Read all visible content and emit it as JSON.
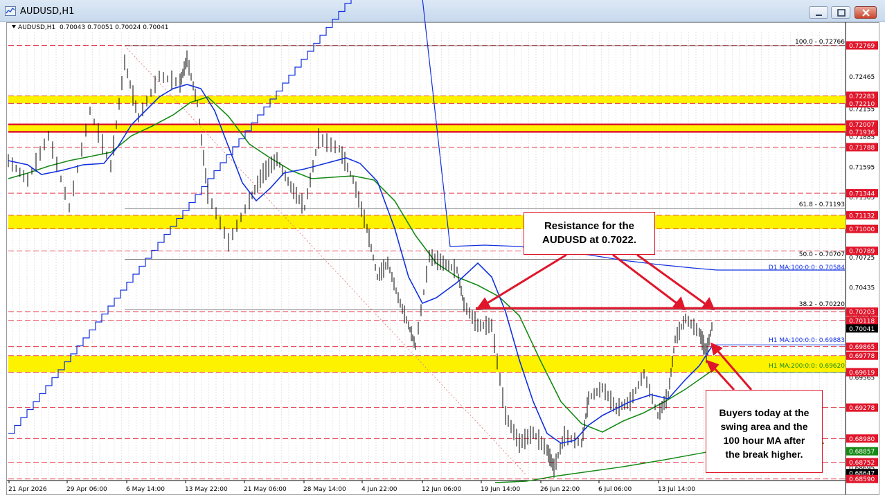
{
  "window": {
    "title": "AUDUSD,H1",
    "buttons": [
      "minimize-button",
      "maximize-button",
      "close-button"
    ]
  },
  "chart_info": {
    "symbol_timeframe": "AUDUSD,H1",
    "ohlc": "0.70043 0.70051 0.70024 0.70041"
  },
  "colors": {
    "zone_yellow": "#fdf200",
    "resistance_red": "#e0162b",
    "ma100_hourly": "#1030e0",
    "ma200_hourly": "#168a16",
    "ma100_daily": "#1030e0",
    "candles": "#000000"
  },
  "price_axis": {
    "ticks": [
      "0.72766",
      "0.72465",
      "0.72155",
      "0.71885",
      "0.71595",
      "0.71305",
      "0.71015",
      "0.70725",
      "0.70435",
      "0.70145",
      "0.69855",
      "0.69565",
      "0.69275",
      "0.68985",
      "0.68695"
    ],
    "tags": [
      {
        "text": "0.72769",
        "color": "#e0162b"
      },
      {
        "text": "0.72283",
        "color": "#e0162b"
      },
      {
        "text": "0.72210",
        "color": "#e0162b"
      },
      {
        "text": "0.72007",
        "color": "#e0162b"
      },
      {
        "text": "0.71936",
        "color": "#e0162b"
      },
      {
        "text": "0.71788",
        "color": "#e0162b"
      },
      {
        "text": "0.71344",
        "color": "#e0162b"
      },
      {
        "text": "0.71132",
        "color": "#e0162b"
      },
      {
        "text": "0.71000",
        "color": "#e0162b"
      },
      {
        "text": "0.70789",
        "color": "#e0162b"
      },
      {
        "text": "0.70203",
        "color": "#e0162b"
      },
      {
        "text": "0.70118",
        "color": "#e0162b"
      },
      {
        "text": "0.70041",
        "color": "#000000"
      },
      {
        "text": "0.69865",
        "color": "#e0162b"
      },
      {
        "text": "0.69778",
        "color": "#e0162b"
      },
      {
        "text": "0.69619",
        "color": "#e0162b"
      },
      {
        "text": "0.69278",
        "color": "#e0162b"
      },
      {
        "text": "0.68980",
        "color": "#e0162b"
      },
      {
        "text": "0.68857",
        "color": "#168a16"
      },
      {
        "text": "0.68752",
        "color": "#e0162b"
      },
      {
        "text": "0.68647",
        "color": "#000000"
      },
      {
        "text": "0.68590",
        "color": "#e0162b"
      }
    ]
  },
  "time_axis": {
    "labels": [
      "21 Apr 2026",
      "29 Apr 06:00",
      "6 May 14:00",
      "13 May 22:00",
      "21 May 06:00",
      "28 May 14:00",
      "4 Jun 22:00",
      "12 Jun 06:00",
      "19 Jun 14:00",
      "26 Jun 22:00",
      "6 Jul 06:00",
      "13 Jul 14:00"
    ]
  },
  "fibonacci": [
    {
      "label": "100.0 - 0.72766"
    },
    {
      "label": "61.8 - 0.71193"
    },
    {
      "label": "50.0 - 0.70707"
    },
    {
      "label": "38.2 - 0.70220"
    }
  ],
  "ma_labels": {
    "daily_100": "D1 MA:100:0:0: 0.70584",
    "hourly_100": "H1 MA:100:0:0: 0.69883",
    "hourly_200": "H1 MA:200:0:0: 0.69620"
  },
  "callouts": {
    "resistance": [
      "Resistance for the",
      "AUDUSD at 0.7022."
    ],
    "buyers": [
      "Buyers today at the",
      "swing area and the",
      "100 hour MA after",
      "the break higher."
    ]
  }
}
